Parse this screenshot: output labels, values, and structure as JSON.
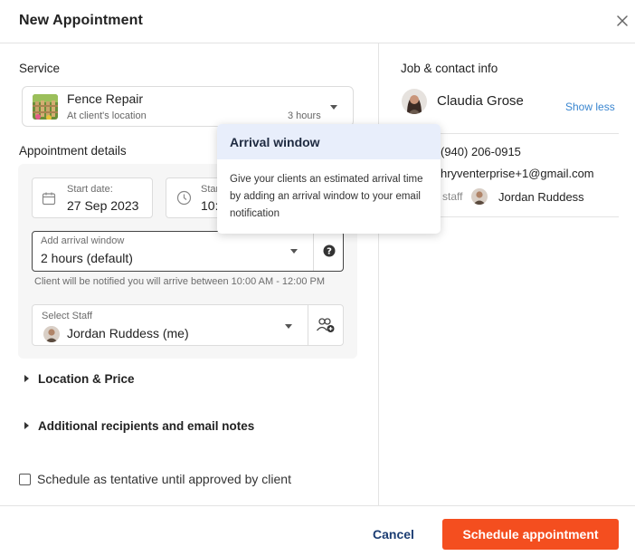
{
  "dialog": {
    "title": "New Appointment",
    "close_icon": "close-icon"
  },
  "service": {
    "section_label": "Service",
    "name": "Fence Repair",
    "location": "At client's location",
    "duration": "3 hours"
  },
  "appointment": {
    "section_label": "Appointment details",
    "start_date_label": "Start date:",
    "start_date_value": "27 Sep 2023",
    "start_time_label": "Start time:",
    "start_time_value": "10:00 AM",
    "arrival_label": "Add arrival window",
    "arrival_value": "2 hours (default)",
    "arrival_hint": "Client will be notified you will arrive between 10:00 AM - 12:00 PM",
    "staff_label": "Select Staff",
    "staff_value": "Jordan Ruddess (me)"
  },
  "expanders": {
    "location_price": "Location & Price",
    "recipients": "Additional recipients and email notes"
  },
  "tentative": {
    "label": "Schedule as tentative until approved by client",
    "checked": false
  },
  "footer": {
    "cancel": "Cancel",
    "primary": "Schedule appointment"
  },
  "contact": {
    "section_label": "Job & contact info",
    "name": "Claudia Grose",
    "show_less": "Show less",
    "phone": "(940) 206-0915",
    "email": "hryventerprise+1@gmail.com",
    "staff_label": "staff",
    "staff_name": "Jordan Ruddess"
  },
  "tooltip": {
    "title": "Arrival window",
    "body": "Give your clients an estimated arrival time by adding an arrival window to your email notification"
  },
  "colors": {
    "accent": "#f44e1f",
    "link": "#3a86d0",
    "cancel_text": "#1b3d73",
    "tooltip_header": "#e8eefb"
  }
}
